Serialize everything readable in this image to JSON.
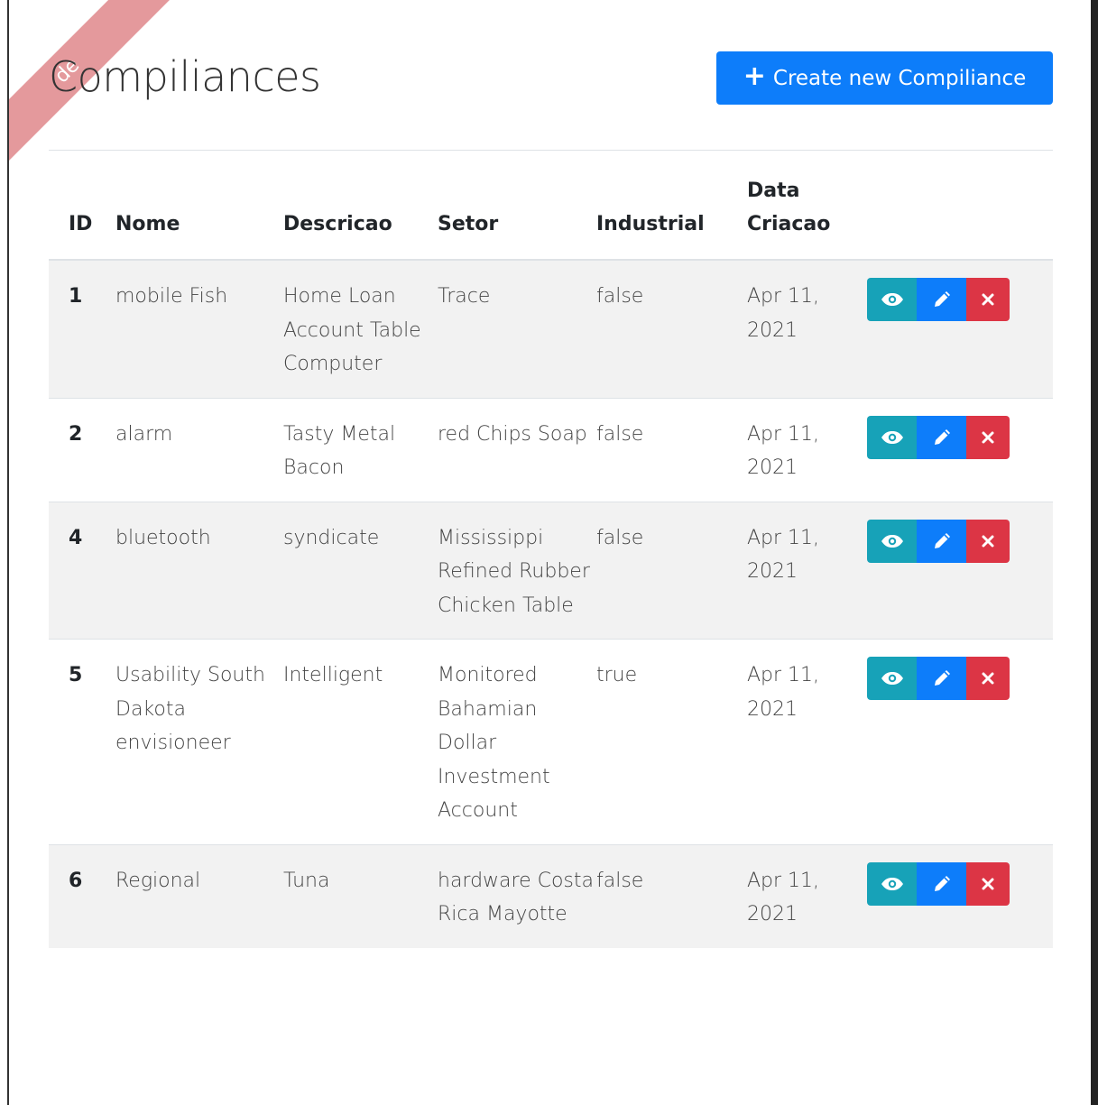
{
  "ribbon": {
    "text": "de"
  },
  "page": {
    "title": "Compiliances",
    "create_label": "Create new Compiliance"
  },
  "table": {
    "headers": {
      "id": "ID",
      "nome": "Nome",
      "descricao": "Descricao",
      "setor": "Setor",
      "industrial": "Industrial",
      "data_criacao": "Data Criacao"
    },
    "rows": [
      {
        "id": "1",
        "nome": "mobile Fish",
        "descricao": "Home Loan Account Table Computer",
        "setor": "Trace",
        "industrial": "false",
        "data": "Apr 11, 2021"
      },
      {
        "id": "2",
        "nome": "alarm",
        "descricao": "Tasty Metal Bacon",
        "setor": "red Chips Soap",
        "industrial": "false",
        "data": "Apr 11, 2021"
      },
      {
        "id": "4",
        "nome": "bluetooth",
        "descricao": "syndicate",
        "setor": "Mississippi Refined Rubber Chicken Table",
        "industrial": "false",
        "data": "Apr 11, 2021"
      },
      {
        "id": "5",
        "nome": "Usability South Dakota envisioneer",
        "descricao": "Intelligent",
        "setor": "Monitored Bahamian Dollar Investment Account",
        "industrial": "true",
        "data": "Apr 11, 2021"
      },
      {
        "id": "6",
        "nome": "Regional",
        "descricao": "Tuna",
        "setor": "hardware Costa Rica Mayotte",
        "industrial": "false",
        "data": "Apr 11, 2021"
      }
    ]
  },
  "icons": {
    "plus": "plus-icon",
    "view": "eye-icon",
    "edit": "pencil-icon",
    "delete": "times-icon"
  },
  "colors": {
    "primary": "#0d7dfa",
    "info": "#17a2b8",
    "danger": "#dc3545",
    "stripe": "#f2f2f2"
  }
}
